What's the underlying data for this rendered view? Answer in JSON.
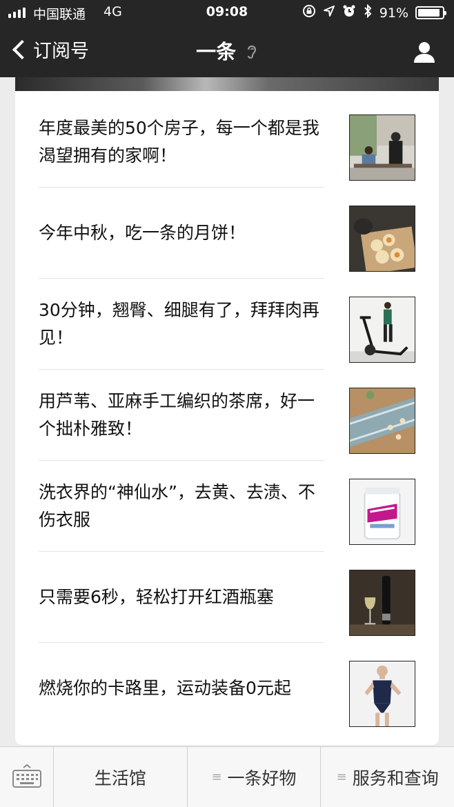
{
  "status_bar": {
    "carrier": "中国联通",
    "network": "4G",
    "time": "09:08",
    "battery": "91%",
    "battery_level": 0.91
  },
  "nav": {
    "back_label": "订阅号",
    "title": "一条",
    "title_icon": "ear-icon"
  },
  "articles": [
    {
      "title": "年度最美的50个房子，每一个都是我渴望拥有的家啊！"
    },
    {
      "title": "今年中秋，吃一条的月饼！"
    },
    {
      "title": "30分钟，翘臀、细腿有了，拜拜肉再见！"
    },
    {
      "title": "用芦苇、亚麻手工编织的茶席，好一个拙朴雅致！"
    },
    {
      "title": "洗衣界的“神仙水”，去黄、去渍、不伤衣服"
    },
    {
      "title": "只需要6秒，轻松打开红酒瓶塞"
    },
    {
      "title": "燃烧你的卡路里，运动装备0元起"
    }
  ],
  "bottom_menu": {
    "keyboard_icon": "keyboard-icon",
    "items": [
      {
        "label": "生活馆"
      },
      {
        "label": "一条好物"
      },
      {
        "label": "服务和查询"
      }
    ]
  },
  "colors": {
    "header_bg": "#262626",
    "page_bg": "#ececec",
    "card_bg": "#ffffff"
  }
}
